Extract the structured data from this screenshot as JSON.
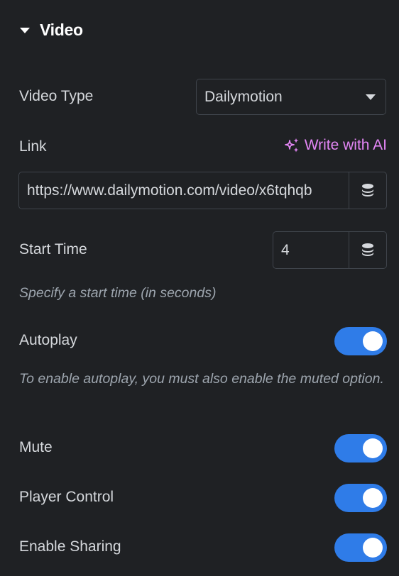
{
  "section": {
    "title": "Video",
    "expanded": true
  },
  "video_type": {
    "label": "Video Type",
    "selected": "Dailymotion"
  },
  "link": {
    "label": "Link",
    "ai_button_label": "Write with AI",
    "value": "https://www.dailymotion.com/video/x6tqhqb",
    "dynamic_icon": "database-icon"
  },
  "start_time": {
    "label": "Start Time",
    "value": "4",
    "dynamic_icon": "database-icon",
    "help": "Specify a start time (in seconds)"
  },
  "autoplay": {
    "label": "Autoplay",
    "enabled": true,
    "help": "To enable autoplay, you must also enable the muted option."
  },
  "mute": {
    "label": "Mute",
    "enabled": true
  },
  "player_control": {
    "label": "Player Control",
    "enabled": true
  },
  "enable_sharing": {
    "label": "Enable Sharing",
    "enabled": true
  },
  "colors": {
    "background": "#1f2124",
    "accent_toggle": "#2f7ce8",
    "ai_link": "#e386f5",
    "border": "#3f444b"
  }
}
